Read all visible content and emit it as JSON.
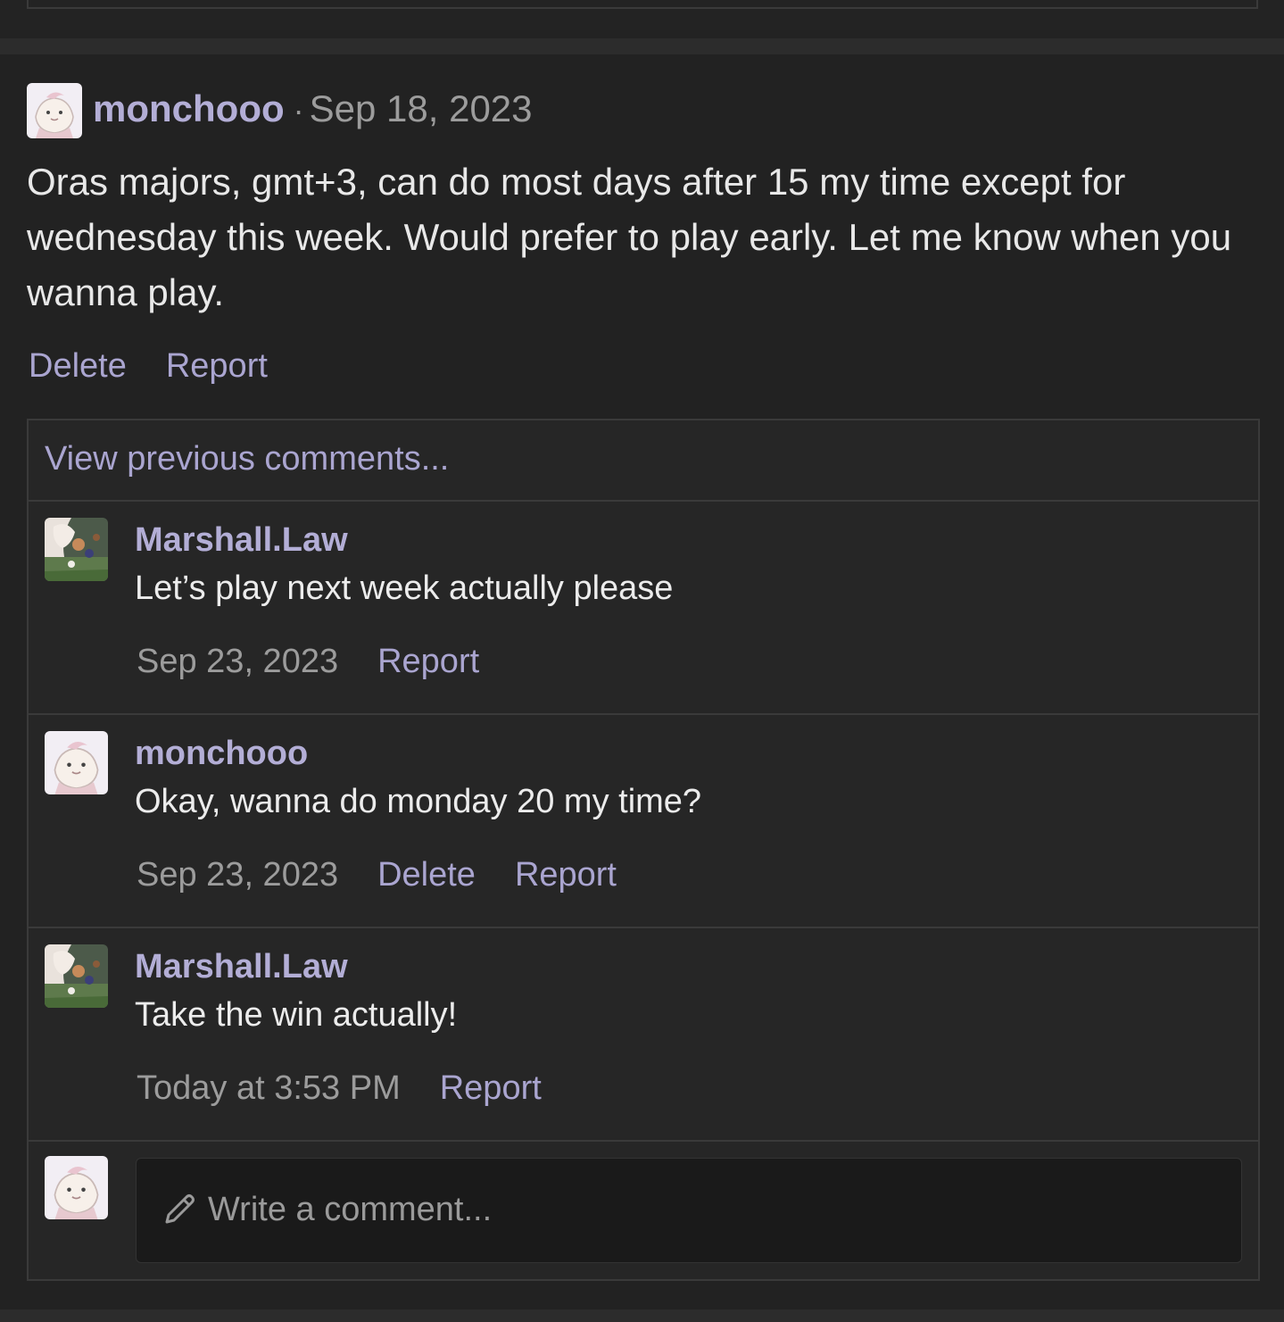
{
  "post": {
    "author": "monchooo",
    "separator": "·",
    "date": "Sep 18, 2023",
    "body": "Oras majors, gmt+3, can do most days after 15 my time except for wednesday this week. Would prefer to play early. Let me know when you wanna play.",
    "actions": [
      "Delete",
      "Report"
    ]
  },
  "comments": {
    "view_previous": "View previous comments...",
    "items": [
      {
        "author": "Marshall.Law",
        "text": "Let’s play next week actually please",
        "date": "Sep 23, 2023",
        "actions": [
          "Report"
        ]
      },
      {
        "author": "monchooo",
        "text": "Okay, wanna do monday 20 my time?",
        "date": "Sep 23, 2023",
        "actions": [
          "Delete",
          "Report"
        ]
      },
      {
        "author": "Marshall.Law",
        "text": "Take the win actually!",
        "date": "Today at 3:53 PM",
        "actions": [
          "Report"
        ]
      }
    ],
    "compose_placeholder": "Write a comment..."
  },
  "icons": {
    "pencil": "pencil-icon",
    "avatar_monchooo": "cream-creature-avatar",
    "avatar_marshall": "anime-character-avatar"
  },
  "colors": {
    "accent_link": "#aaa5d0",
    "author_name": "#b3aed6",
    "background": "#222222"
  }
}
